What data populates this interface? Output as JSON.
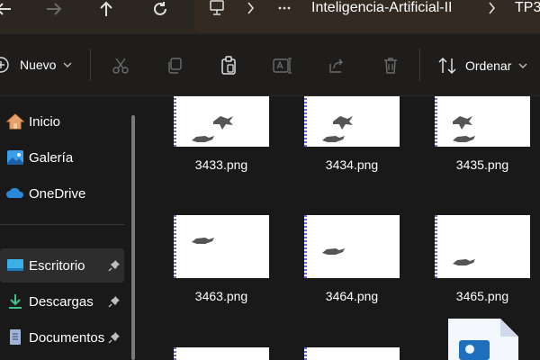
{
  "toolbar": {
    "back_icon": "back-arrow-icon",
    "forward_icon": "forward-arrow-icon",
    "up_icon": "up-arrow-icon",
    "refresh_icon": "refresh-icon"
  },
  "address": {
    "segments": [
      "Inteligencia-Artificial-II",
      "TP3"
    ],
    "icons": [
      "this-pc-icon",
      "chevron-right-icon",
      "more-icon"
    ]
  },
  "commandbar": {
    "new_label": "Nuevo",
    "sort_label": "Ordenar",
    "icons": [
      "cut-icon",
      "copy-icon",
      "paste-icon",
      "rename-icon",
      "share-icon",
      "delete-icon",
      "sort-icon"
    ]
  },
  "sidebar": {
    "items": [
      {
        "label": "Inicio",
        "icon": "home-icon",
        "pinned": false
      },
      {
        "label": "Galería",
        "icon": "gallery-icon",
        "pinned": false
      },
      {
        "label": "OneDrive",
        "icon": "onedrive-icon",
        "pinned": false
      },
      {
        "label": "Escritorio",
        "icon": "desktop-icon",
        "pinned": true
      },
      {
        "label": "Descargas",
        "icon": "downloads-icon",
        "pinned": true
      },
      {
        "label": "Documentos",
        "icon": "documents-icon",
        "pinned": true
      }
    ]
  },
  "files": {
    "row1": [
      "3433.png",
      "3434.png",
      "3435.png"
    ],
    "row2": [
      "3463.png",
      "3464.png",
      "3465.png"
    ]
  },
  "colors": {
    "background": "#191919",
    "accent": "#0078d4",
    "address_bar": "#332b22"
  }
}
